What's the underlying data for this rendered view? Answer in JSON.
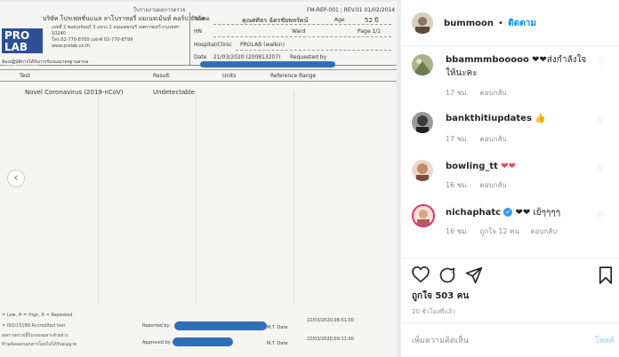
{
  "report": {
    "header_title": "ใบรายงานผลการตรวจ",
    "form_code": "FM-REP-001 ; REV.01 01/02/2014",
    "company_name": "บริษัท โปรเฟสชั่นแนล ลาโบราทอรี่ แมเนจเม้นท์ คอร์ป จำกัด",
    "logo_text": "PRO LAB",
    "logo_sub": "Professional Laboratory Management Corp.",
    "address": "เลขที่ 2 ซอยรุ่งจันทร์ 3 แขวง 2 ถนนเพชรบุรี เขตราชเทวี กรุงเทพฯ 10240",
    "phone": "โทร.02-770-8700 แฟกซ์ 02-770-8799",
    "website": "www.prolab.co.th",
    "accreditation": "ห้องปฏิบัติการได้รับการรับรองมาตรฐานสากล",
    "name_label": "Name",
    "name_value": "คุณศศิธร ฉัตรชัยพลรัตน์",
    "age_label": "Age",
    "age_value": "52 ปี",
    "hn_label": "HN",
    "ward_label": "Ward",
    "page_label": "Page 1/1",
    "hospital_label": "Hospital/Clinic",
    "hospital_value": "PROLAB (walkin)",
    "date_label": "Date",
    "date_value": "21/03/2020 (200813207)",
    "requested_label": "Requested by",
    "col_test": "Test",
    "col_result": "Result",
    "col_units": "Units",
    "col_reference": "Reference Range",
    "test_name": "Novel Coronavirus (2019-nCoV)",
    "test_result": "Undetectable",
    "legend_note": "= Low, H = High, R = Repeated",
    "iso_note": "= ISO/15189 Accredited test",
    "disclaimer1": "ผลการตรวจนี้รับรองเฉพาะตัวอย่าง",
    "disclaimer2": "ห้ามคัดลอกเอกสารโดยไม่ได้รับอนุญาต",
    "reported_by": "Reported by",
    "approved_by": "Approved by",
    "mt_date_label": "M.T. Date",
    "reported_date": "22/03/2020,08:51:00",
    "approved_date": "22/03/2020,09:11:00",
    "carousel_prev": "‹"
  },
  "panel": {
    "owner_username": "bummoon",
    "separator": "•",
    "follow_label": "ติดตาม",
    "comments": [
      {
        "username": "bbammmbooooo",
        "text": "❤❤ส่งกำลังใจให้นะคะ",
        "time": "17 ชม.",
        "reply": "ตอบกลับ"
      },
      {
        "username": "bankthitiupdates",
        "text": "👍",
        "time": "17 ชม.",
        "reply": "ตอบกลับ"
      },
      {
        "username": "bowling_tt",
        "text": "❤❤",
        "time": "16 ชม.",
        "reply": "ตอบกลับ"
      },
      {
        "username": "nichaphatc",
        "text": "❤❤ เย้ๆๆๆๆ",
        "time": "16 ชม.",
        "likes": "ถูกใจ 12 คน",
        "reply": "ตอบกลับ"
      }
    ],
    "like_count": "ถูกใจ 503 คน",
    "post_time": "20 ชั่วโมงที่แล้ว",
    "comment_placeholder": "เพิ่มความคิดเห็น",
    "post_label": "โพสต์"
  },
  "colors": {
    "accent": "#0095f6",
    "heart": "#ed4956",
    "redaction": "#2f6fb8",
    "logo": "#2c4f96"
  }
}
